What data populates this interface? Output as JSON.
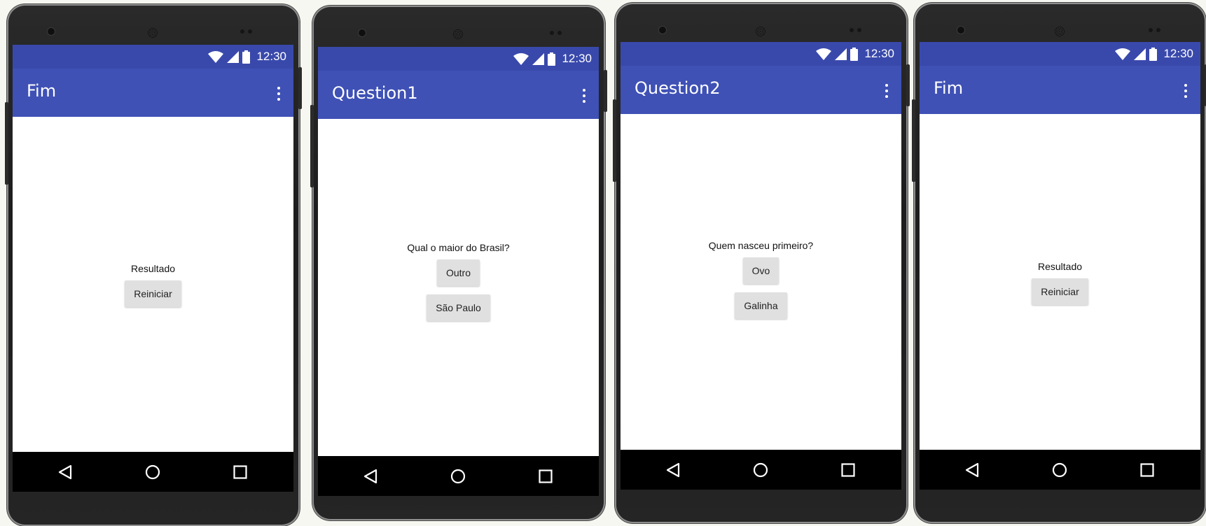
{
  "theme": {
    "status_bar_color": "#3949ab",
    "toolbar_color": "#3f51b5",
    "nav_bar_color": "#000000",
    "button_color": "#e0e0e0"
  },
  "phones": [
    {
      "status": {
        "time": "12:30",
        "icons": [
          "wifi-icon",
          "signal-icon",
          "battery-icon"
        ]
      },
      "toolbar": {
        "title": "Fim",
        "menu_icon": "overflow-menu-icon"
      },
      "label": "Resultado",
      "buttons": [
        "Reiniciar"
      ],
      "nav": [
        "back-icon",
        "home-icon",
        "recents-icon"
      ]
    },
    {
      "status": {
        "time": "12:30",
        "icons": [
          "wifi-icon",
          "signal-icon",
          "battery-icon"
        ]
      },
      "toolbar": {
        "title": "Question1",
        "menu_icon": "overflow-menu-icon"
      },
      "label": "Qual o maior do Brasil?",
      "buttons": [
        "Outro",
        "São Paulo"
      ],
      "nav": [
        "back-icon",
        "home-icon",
        "recents-icon"
      ]
    },
    {
      "status": {
        "time": "12:30",
        "icons": [
          "wifi-icon",
          "signal-icon",
          "battery-icon"
        ]
      },
      "toolbar": {
        "title": "Question2",
        "menu_icon": "overflow-menu-icon"
      },
      "label": "Quem nasceu primeiro?",
      "buttons": [
        "Ovo",
        "Galinha"
      ],
      "nav": [
        "back-icon",
        "home-icon",
        "recents-icon"
      ]
    },
    {
      "status": {
        "time": "12:30",
        "icons": [
          "wifi-icon",
          "signal-icon",
          "battery-icon"
        ]
      },
      "toolbar": {
        "title": "Fim",
        "menu_icon": "overflow-menu-icon"
      },
      "label": "Resultado",
      "buttons": [
        "Reiniciar"
      ],
      "nav": [
        "back-icon",
        "home-icon",
        "recents-icon"
      ]
    }
  ]
}
